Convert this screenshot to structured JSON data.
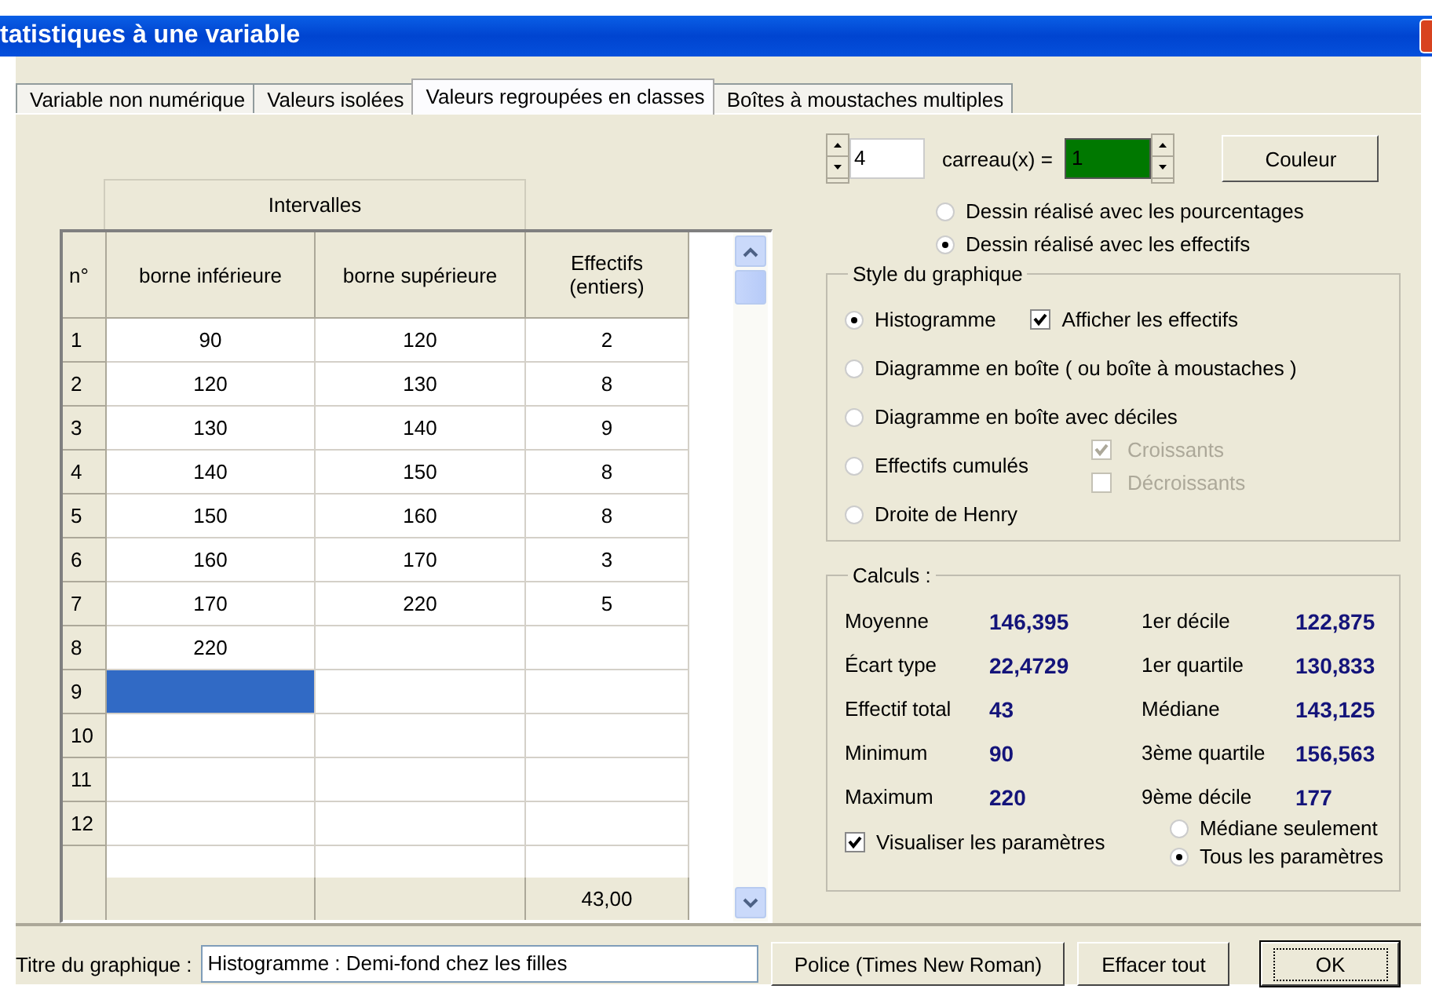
{
  "window": {
    "title": "tatistiques à une variable"
  },
  "tabs": [
    {
      "label": "Variable non numérique",
      "selected": false
    },
    {
      "label": "Valeurs isolées",
      "selected": false
    },
    {
      "label": "Valeurs regroupées en classes",
      "selected": true
    },
    {
      "label": "Boîtes à moustaches multiples",
      "selected": false
    }
  ],
  "table": {
    "group_header": "Intervalles",
    "columns": [
      "n°",
      "borne inférieure",
      "borne supérieure",
      "Effectifs (entiers)"
    ],
    "rows": [
      {
        "n": "1",
        "lower": "90",
        "upper": "120",
        "count": "2",
        "selected": false
      },
      {
        "n": "2",
        "lower": "120",
        "upper": "130",
        "count": "8",
        "selected": false
      },
      {
        "n": "3",
        "lower": "130",
        "upper": "140",
        "count": "9",
        "selected": false
      },
      {
        "n": "4",
        "lower": "140",
        "upper": "150",
        "count": "8",
        "selected": false
      },
      {
        "n": "5",
        "lower": "150",
        "upper": "160",
        "count": "8",
        "selected": false
      },
      {
        "n": "6",
        "lower": "160",
        "upper": "170",
        "count": "3",
        "selected": false
      },
      {
        "n": "7",
        "lower": "170",
        "upper": "220",
        "count": "5",
        "selected": false
      },
      {
        "n": "8",
        "lower": "220",
        "selected": false
      },
      {
        "n": "9",
        "selected": true
      },
      {
        "n": "10",
        "selected": false
      },
      {
        "n": "11",
        "selected": false
      },
      {
        "n": "12",
        "selected": false
      },
      {
        "selected": false
      }
    ],
    "total": "43,00"
  },
  "scale": {
    "value": "4",
    "label": "carreau(x) =",
    "unit_value": "1",
    "color_button": "Couleur"
  },
  "drawing_mode": [
    {
      "label": "Dessin réalisé avec les pourcentages",
      "selected": false
    },
    {
      "label": "Dessin réalisé avec les effectifs",
      "selected": true
    }
  ],
  "style_group": {
    "title": "Style du graphique",
    "options": [
      {
        "label": "Histogramme",
        "selected": true
      },
      {
        "label": "Diagramme en boîte ( ou boîte à moustaches )",
        "selected": false
      },
      {
        "label": "Diagramme en boîte avec déciles",
        "selected": false
      },
      {
        "label": "Effectifs cumulés",
        "selected": false
      },
      {
        "label": "Droite de Henry",
        "selected": false
      }
    ],
    "show_counts": {
      "label": "Afficher les effectifs",
      "checked": true
    },
    "cumulative": [
      {
        "label": "Croissants",
        "checked": true,
        "disabled": true
      },
      {
        "label": "Décroissants",
        "checked": false,
        "disabled": true
      }
    ]
  },
  "calculs": {
    "title": "Calculs :",
    "stats": [
      {
        "label": "Moyenne",
        "value": "146,395"
      },
      {
        "label": "1er décile",
        "value": "122,875"
      },
      {
        "label": "Écart type",
        "value": "22,4729"
      },
      {
        "label": "1er quartile",
        "value": "130,833"
      },
      {
        "label": "Effectif total",
        "value": "43"
      },
      {
        "label": "Médiane",
        "value": "143,125"
      },
      {
        "label": "Minimum",
        "value": "90"
      },
      {
        "label": "3ème quartile",
        "value": "156,563"
      },
      {
        "label": "Maximum",
        "value": "220"
      },
      {
        "label": "9ème décile",
        "value": "177"
      }
    ],
    "show_params": {
      "label": "Visualiser les paramètres",
      "checked": true
    },
    "param_mode": [
      {
        "label": "Médiane seulement",
        "selected": false
      },
      {
        "label": "Tous les paramètres",
        "selected": true
      }
    ]
  },
  "footer": {
    "title_label": "Titre du graphique :",
    "title_value": "Histogramme : Demi-fond chez les filles",
    "buttons": [
      {
        "label": "Police (Times New Roman)",
        "focused": false
      },
      {
        "label": "Effacer tout",
        "focused": false
      },
      {
        "label": "OK",
        "focused": true
      }
    ]
  }
}
